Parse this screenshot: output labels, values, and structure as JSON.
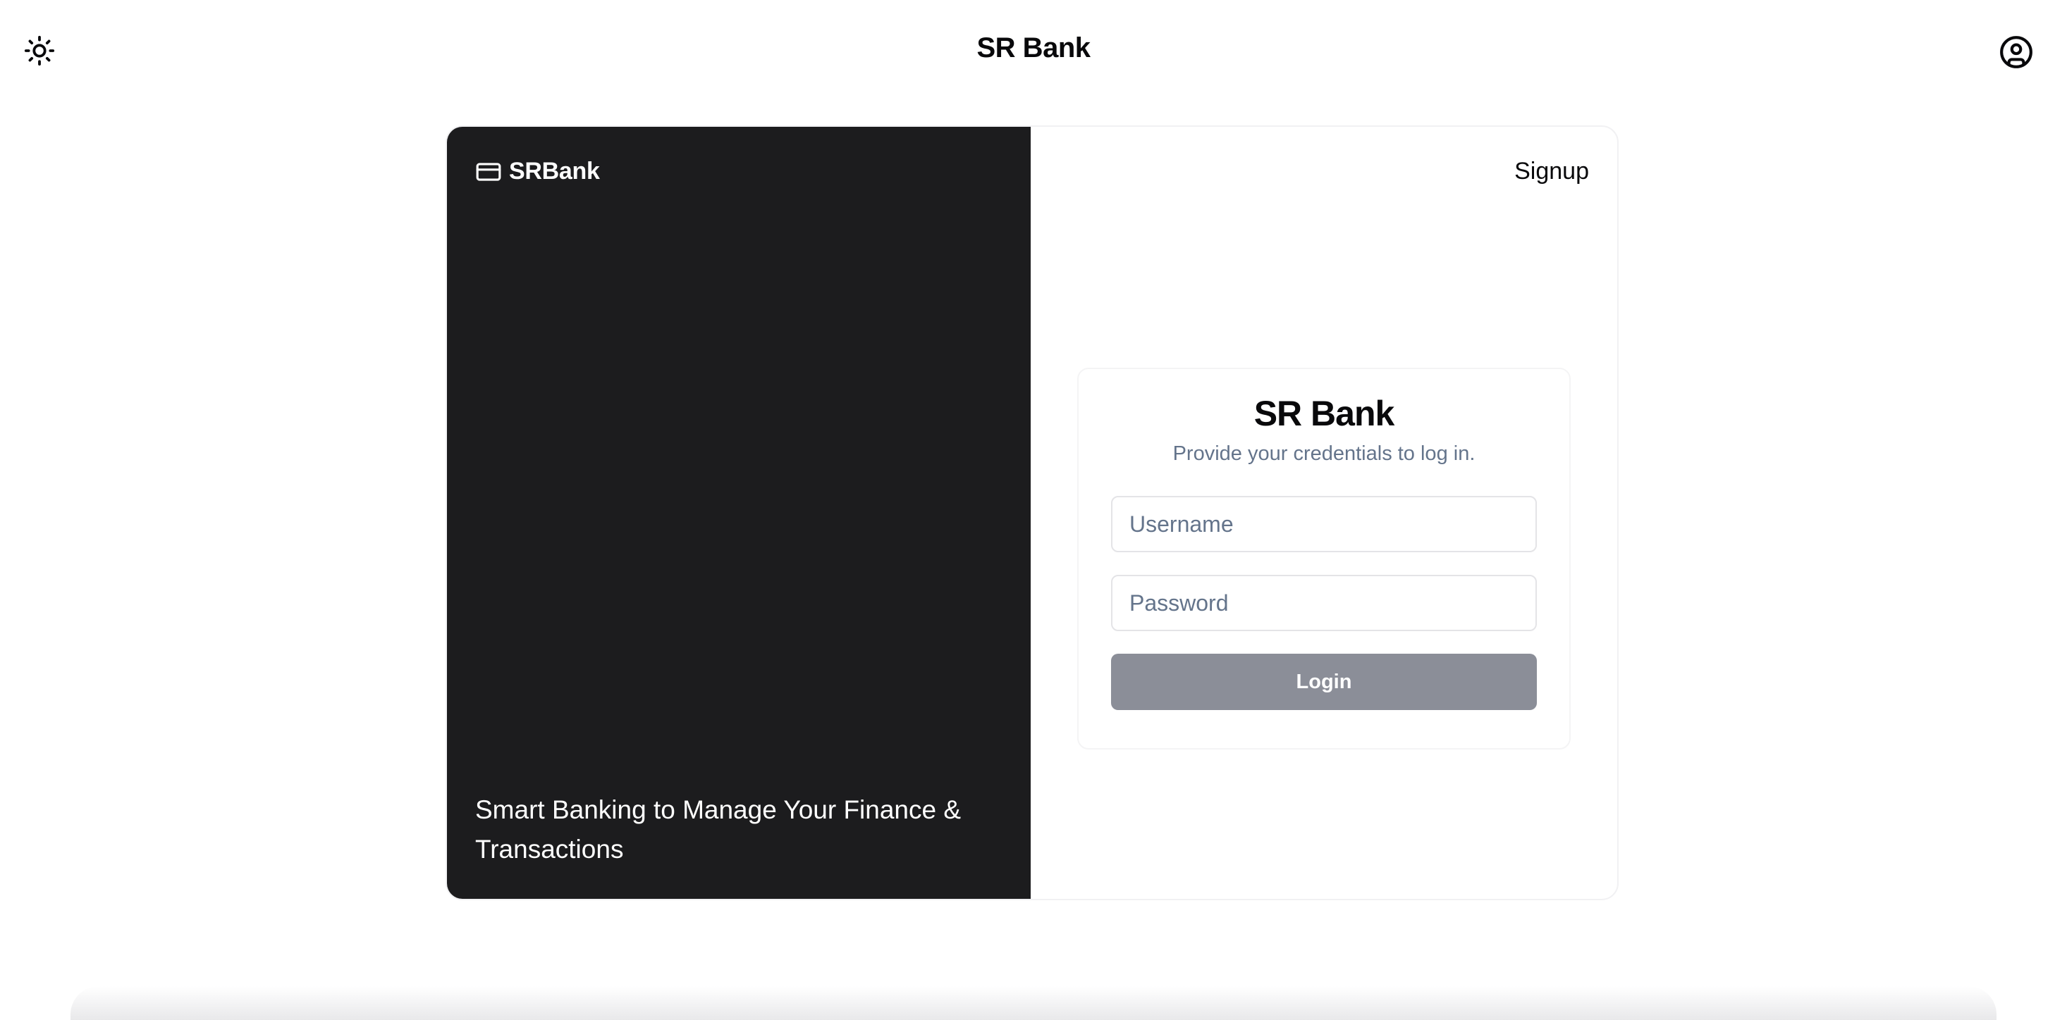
{
  "header": {
    "title": "SR Bank",
    "theme_icon": "sun-icon",
    "account_icon": "user-circle-icon"
  },
  "left_panel": {
    "brand_icon": "credit-card-icon",
    "brand_name": "SRBank",
    "tagline": "Smart Banking to Manage Your Finance & Transactions"
  },
  "right_panel": {
    "signup_label": "Signup",
    "login": {
      "title": "SR Bank",
      "subtitle": "Provide your credentials to log in.",
      "username_placeholder": "Username",
      "password_placeholder": "Password",
      "button_label": "Login"
    }
  },
  "colors": {
    "left_panel_bg": "#1c1c1e",
    "button_bg": "#8b8e98",
    "muted_text": "#64748b"
  }
}
